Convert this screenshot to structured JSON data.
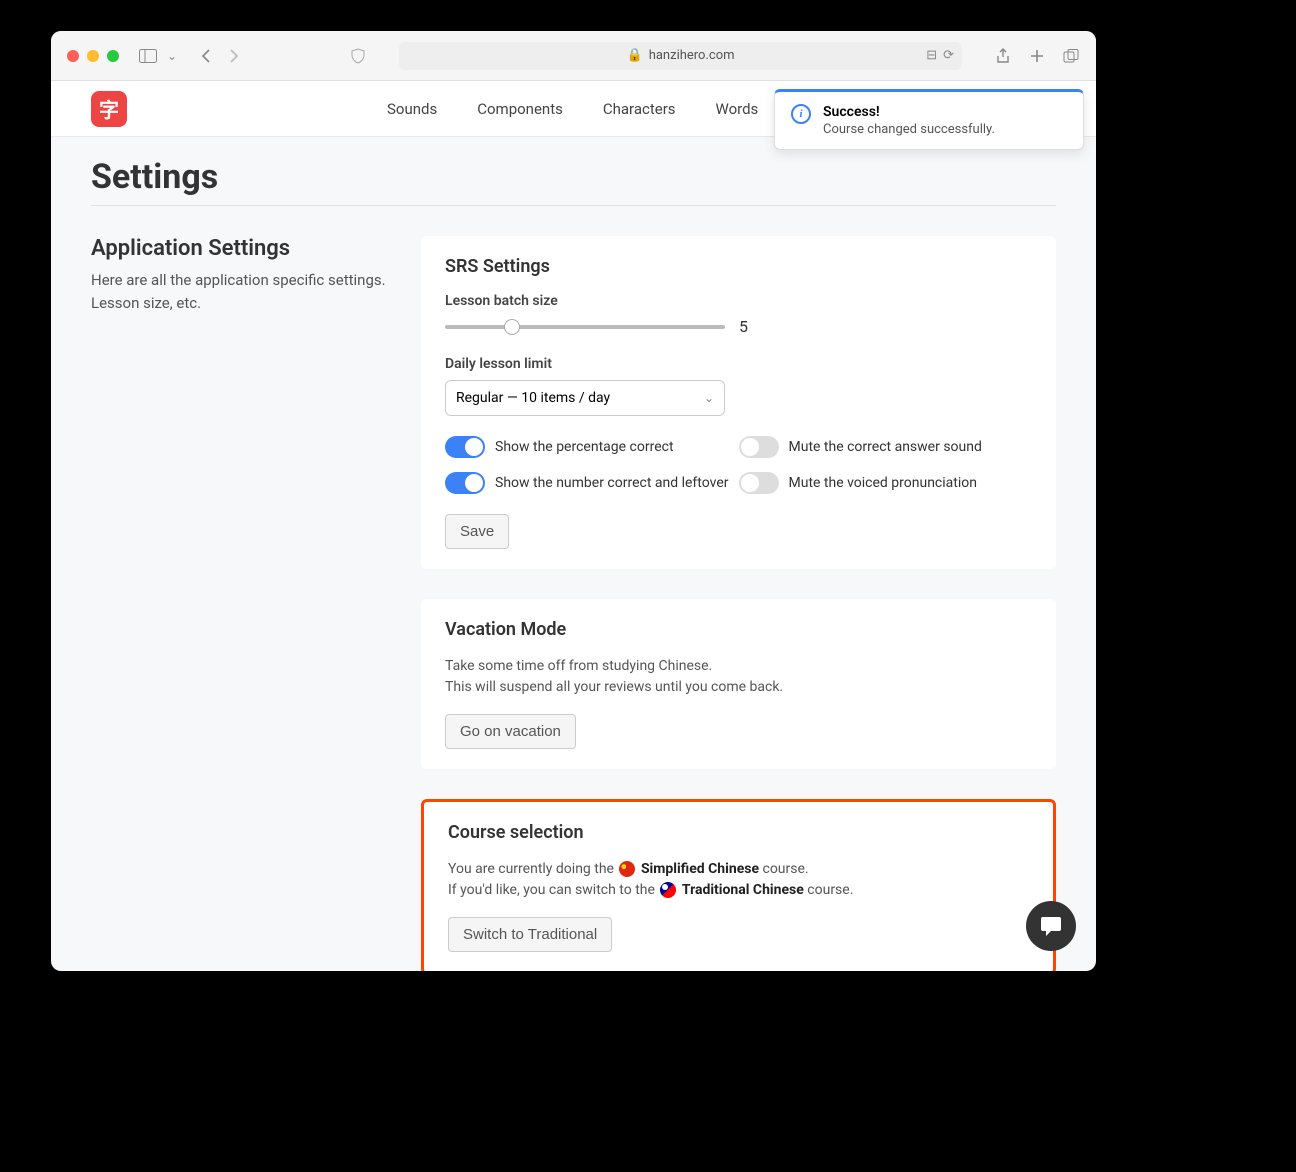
{
  "browser": {
    "url": "hanzihero.com"
  },
  "logo_char": "字",
  "nav": [
    "Sounds",
    "Components",
    "Characters",
    "Words"
  ],
  "toast": {
    "title": "Success!",
    "message": "Course changed successfully."
  },
  "page_title": "Settings",
  "sidebar": {
    "heading": "Application Settings",
    "description": "Here are all the application specific settings. Lesson size, etc."
  },
  "srs": {
    "title": "SRS Settings",
    "batch_label": "Lesson batch size",
    "batch_value": "5",
    "daily_label": "Daily lesson limit",
    "daily_value": "Regular — 10 items / day",
    "toggles": [
      {
        "on": true,
        "label": "Show the percentage correct"
      },
      {
        "on": false,
        "label": "Mute the correct answer sound"
      },
      {
        "on": true,
        "label": "Show the number correct and leftover"
      },
      {
        "on": false,
        "label": "Mute the voiced pronunciation"
      }
    ],
    "save": "Save"
  },
  "vacation": {
    "title": "Vacation Mode",
    "text1": "Take some time off from studying Chinese.",
    "text2": "This will suspend all your reviews until you come back.",
    "button": "Go on vacation"
  },
  "course": {
    "title": "Course selection",
    "line1_pre": "You are currently doing the ",
    "line1_bold": "Simplified Chinese",
    "line1_post": " course.",
    "line2_pre": "If you'd like, you can switch to the ",
    "line2_bold": "Traditional Chinese",
    "line2_post": " course.",
    "button": "Switch to Traditional"
  }
}
